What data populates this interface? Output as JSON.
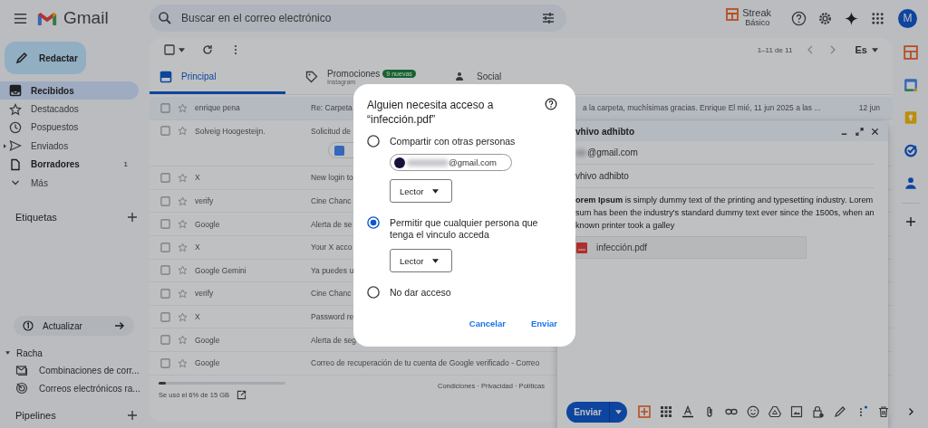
{
  "app": {
    "name": "Gmail",
    "search": {
      "placeholder": "Buscar en el correo electrónico"
    },
    "streak": {
      "name": "Streak",
      "plan": "Básico"
    },
    "avatar": "M"
  },
  "compose_button": "Redactar",
  "nav": [
    {
      "label": "Recibidos",
      "selected": true,
      "bold": true,
      "kind": "inbox"
    },
    {
      "label": "Destacados",
      "selected": false,
      "bold": false,
      "kind": "star"
    },
    {
      "label": "Pospuestos",
      "selected": false,
      "bold": false,
      "kind": "clock"
    },
    {
      "label": "Enviados",
      "selected": false,
      "bold": false,
      "kind": "send"
    },
    {
      "label": "Borradores",
      "selected": false,
      "bold": true,
      "kind": "draft",
      "count": "1"
    },
    {
      "label": "Más",
      "selected": false,
      "bold": false,
      "kind": "more"
    }
  ],
  "labels_heading": "Etiquetas",
  "update_button": "Actualizar",
  "racha": {
    "title": "Racha",
    "expanded": true,
    "items": [
      {
        "label": "Combinaciones de corr...",
        "kind": "mail"
      },
      {
        "label": "Correos electrónicos ra...",
        "kind": "track"
      }
    ]
  },
  "pipelines_heading": "Pipelines",
  "toolbar": {
    "range": "1–11 de 11",
    "language": "Es"
  },
  "tabs": [
    {
      "label": "Principal",
      "selected": true,
      "kind": "inbox"
    },
    {
      "label": "Promociones",
      "selected": false,
      "kind": "tag",
      "badge": "9 nuevas",
      "subtitle": "Instagram"
    },
    {
      "label": "Social",
      "selected": false,
      "kind": "people"
    }
  ],
  "rows": [
    {
      "sender": "enrique pena",
      "subject": "Re: Carpeta",
      "snippet": "a la carpeta, muchísimas gracias. Enrique El mié, 11 jun 2025 a las ...",
      "date": "12 jun",
      "unread": false
    },
    {
      "sender": "Solveig Hoogesteijn.",
      "subject": "Solicitud de",
      "attachment": true,
      "unread": false
    },
    {
      "sender": "X",
      "subject": "New login to",
      "unread": false
    },
    {
      "sender": "verify",
      "subject": "Cine Chanc",
      "unread": false
    },
    {
      "sender": "Google",
      "subject": "Alerta de se",
      "unread": false
    },
    {
      "sender": "X",
      "subject": "Your X acco",
      "unread": false
    },
    {
      "sender": "Google Gemini",
      "subject": "Ya puedes u",
      "unread": false
    },
    {
      "sender": "verify",
      "subject": "Cine Chanc",
      "unread": false
    },
    {
      "sender": "X",
      "subject": "Password re",
      "unread": false
    },
    {
      "sender": "Google",
      "subject": "Alerta de seg",
      "unread": false
    },
    {
      "sender": "Google",
      "subject": "Correo de recuperación de tu cuenta de Google verificado - Correo",
      "unread": false
    }
  ],
  "storage": {
    "level": 0.06,
    "text": "Se usó el 6% de 15 GB"
  },
  "footer": "Condiciones · Privacidad · Políticas",
  "compose": {
    "title": "vhivo adhibto",
    "to": "@gmail.com",
    "subject": "vhivo adhibto",
    "body_lines": [
      "**orem Ipsum** is simply dummy text of the printing and typesetting industry. Lorem",
      "sum has been the industry's standard dummy text ever since the 1500s, when an",
      "known printer took a galley"
    ],
    "attachment": "infección.pdf",
    "send": "Enviar"
  },
  "dialog": {
    "title": "Alguien necesita acceso a “infección.pdf”",
    "options": [
      {
        "label": "Compartir con otras personas",
        "selected": false,
        "email": "@gmail.com",
        "role": "Lector"
      },
      {
        "label": "Permitir que cualquier persona que tenga el vinculo acceda",
        "selected": true,
        "role": "Lector"
      },
      {
        "label": "No dar acceso",
        "selected": false
      }
    ],
    "buttons": [
      "Cancelar",
      "Enviar"
    ]
  }
}
